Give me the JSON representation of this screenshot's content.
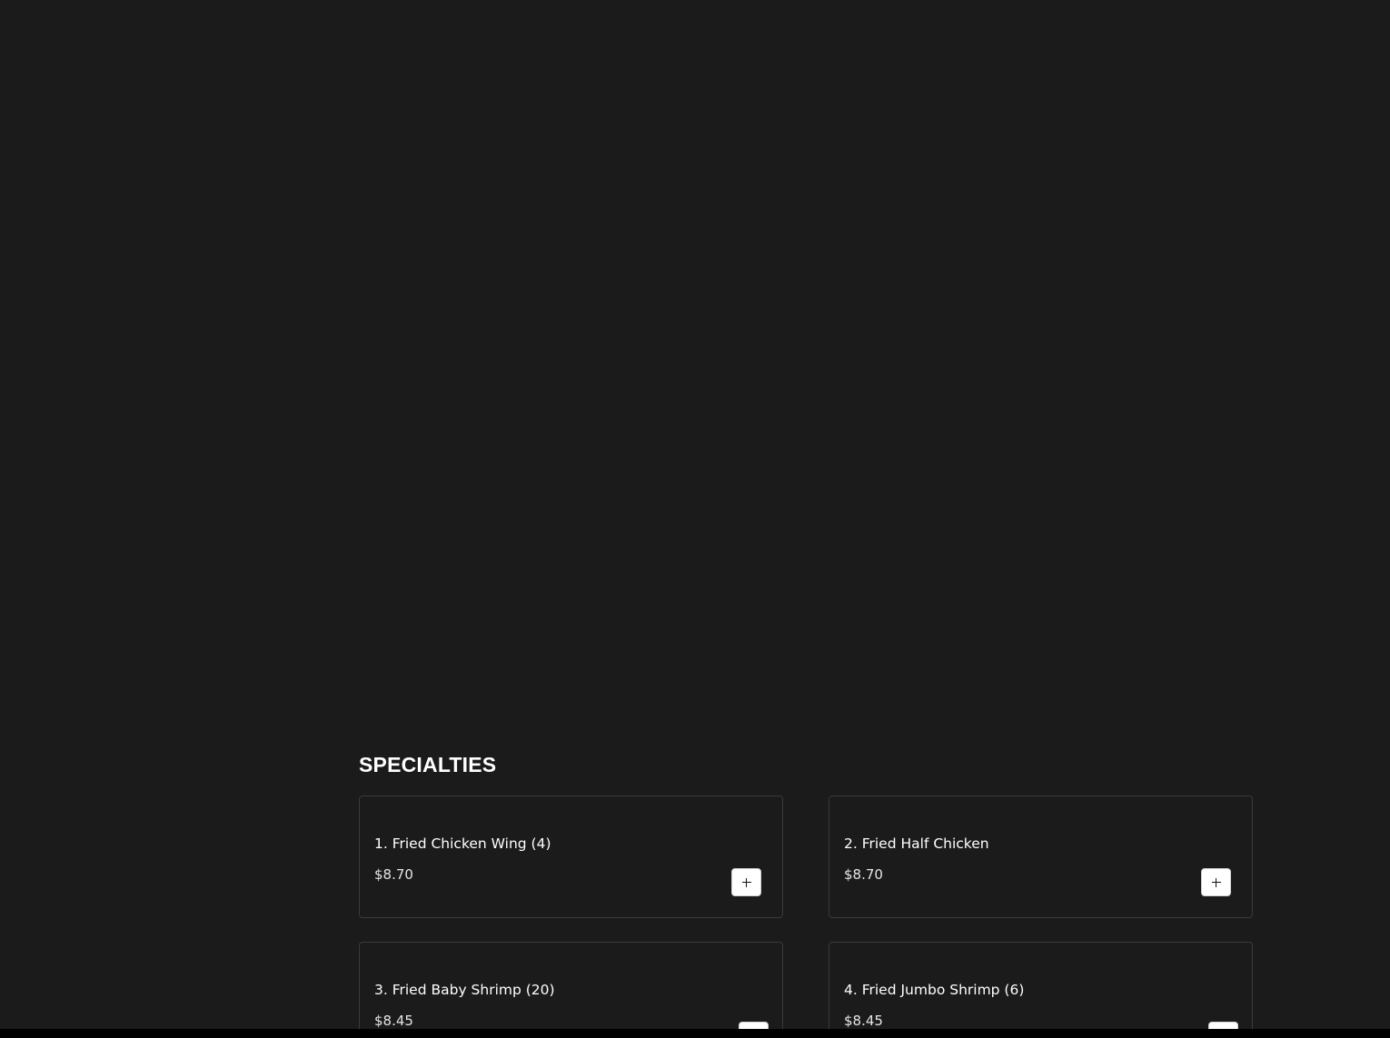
{
  "section": {
    "title": "SPECIALTIES"
  },
  "items": [
    {
      "name": "1. Fried Chicken Wing (4)",
      "price": "$8.70",
      "add_icon": "plus-icon"
    },
    {
      "name": "2. Fried Half Chicken",
      "price": "$8.70",
      "add_icon": "plus-icon"
    },
    {
      "name": "3. Fried Baby Shrimp (20)",
      "price": "$8.45",
      "add_icon": "plus-icon"
    },
    {
      "name": "4. Fried Jumbo Shrimp (6)",
      "price": "$8.45",
      "add_icon": "plus-icon"
    }
  ],
  "colors": {
    "background": "#1b1b1b",
    "text": "#ffffff",
    "card_border": "#3a3a3a",
    "button_bg": "#ffffff"
  }
}
